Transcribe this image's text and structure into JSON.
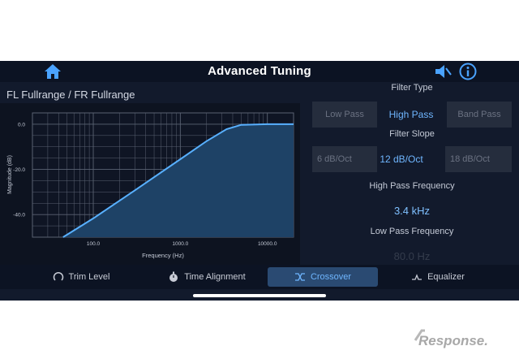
{
  "header": {
    "title": "Advanced Tuning",
    "icons": {
      "home": "home-icon",
      "speaker": "speaker-mute-icon",
      "info": "info-icon"
    }
  },
  "channel_label": "FL Fullrange / FR Fullrange",
  "chart_data": {
    "type": "line",
    "title": "",
    "xlabel": "Frequency (Hz)",
    "ylabel": "Magnitude (dB)",
    "x_scale": "log",
    "xlim": [
      20,
      20000
    ],
    "ylim": [
      -50,
      5
    ],
    "xticks": [
      "100.0",
      "1000.0",
      "10000.0"
    ],
    "yticks": [
      "0.0",
      "-20.0",
      "-40.0"
    ],
    "grid": true,
    "series": [
      {
        "x": [
          45,
          100,
          300,
          1000,
          2000,
          3400,
          5000,
          10000,
          20000
        ],
        "values": [
          -50,
          -41.7,
          -29.3,
          -15.5,
          -7.5,
          -2.2,
          -0.3,
          0,
          0
        ]
      }
    ],
    "fill": true,
    "colors": {
      "line": "#58b0ff",
      "fill": "#1e4266",
      "grid": "#5a6272",
      "background": "#0f1524"
    }
  },
  "filter_type": {
    "title": "Filter Type",
    "options": [
      "Low Pass",
      "High Pass",
      "Band Pass"
    ],
    "selected": "High Pass"
  },
  "filter_slope": {
    "title": "Filter Slope",
    "options": [
      "6 dB/Oct",
      "12 dB/Oct",
      "18 dB/Oct"
    ],
    "selected": "12 dB/Oct"
  },
  "high_pass": {
    "title": "High Pass Frequency",
    "value": "3.4 kHz"
  },
  "low_pass": {
    "title": "Low Pass Frequency",
    "value": "80.0 Hz"
  },
  "tabs": [
    {
      "label": "Trim Level",
      "icon": "knob-icon"
    },
    {
      "label": "Time Alignment",
      "icon": "stopwatch-icon"
    },
    {
      "label": "Crossover",
      "icon": "crossover-icon",
      "active": true
    },
    {
      "label": "Equalizer",
      "icon": "equalizer-icon"
    }
  ],
  "watermark": "Response."
}
